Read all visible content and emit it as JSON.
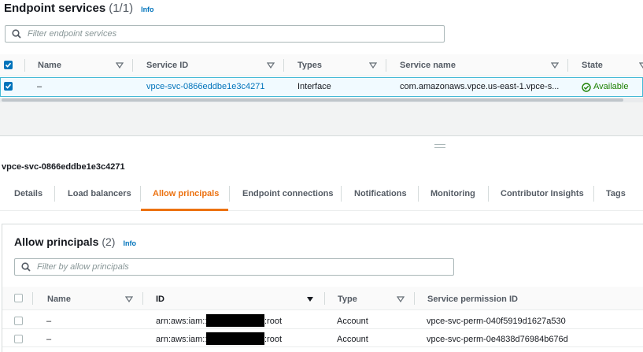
{
  "top": {
    "title": "Endpoint services",
    "count": "(1/1)",
    "info": "Info",
    "search_placeholder": "Filter endpoint services",
    "columns": [
      "Name",
      "Service ID",
      "Types",
      "Service name",
      "State"
    ],
    "row": {
      "name": "–",
      "service_id": "vpce-svc-0866eddbe1e3c4271",
      "type": "Interface",
      "service_name": "com.amazonaws.vpce.us-east-1.vpce-s...",
      "state": "Available"
    }
  },
  "detail": {
    "title": "vpce-svc-0866eddbe1e3c4271",
    "tabs": [
      "Details",
      "Load balancers",
      "Allow principals",
      "Endpoint connections",
      "Notifications",
      "Monitoring",
      "Contributor Insights",
      "Tags"
    ],
    "active_tab": "Allow principals"
  },
  "principals": {
    "title": "Allow principals",
    "count": "(2)",
    "info": "Info",
    "search_placeholder": "Filter by allow principals",
    "columns": [
      "Name",
      "ID",
      "Type",
      "Service permission ID"
    ],
    "rows": [
      {
        "name": "–",
        "id_prefix": "arn:aws:iam::",
        "id_suffix": ":root",
        "type": "Account",
        "permission_id": "vpce-svc-perm-040f5919d1627a530"
      },
      {
        "name": "–",
        "id_prefix": "arn:aws:iam::",
        "id_suffix": ":root",
        "type": "Account",
        "permission_id": "vpce-svc-perm-0e4838d76984b676d"
      }
    ]
  },
  "colors": {
    "link": "#0073bb",
    "active_tab": "#ec7211",
    "available": "#1d8102",
    "selected_row_border": "#44b9d6"
  }
}
